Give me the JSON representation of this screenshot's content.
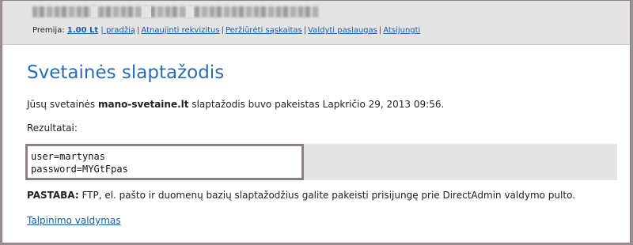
{
  "nav": {
    "premium_label": "Premija:",
    "premium_amount": "1.00 Lt",
    "links": [
      "| pradžią",
      "Atnaujinti rekvizitus",
      "Peržiūrėti sąskaitas",
      "Valdyti paslaugas",
      "Atsijungti"
    ]
  },
  "main": {
    "title": "Svetainės slaptažodis",
    "message_prefix": "Jūsų svetainės ",
    "site_name": "mano-svetaine.lt",
    "message_suffix": " slaptažodis buvo pakeistas Lapkričio 29, 2013 09:56.",
    "results_label": "Rezultatai:",
    "result_lines": [
      "user=martynas",
      "password=MYGtFpas"
    ],
    "note_label": "PASTABA:",
    "note_text": " FTP, el. pašto ir duomenų bazių slaptažodžius galite pakeisti prisijungę prie DirectAdmin valdymo pulto.",
    "footer_link": "Talpinimo valdymas"
  },
  "colors": {
    "title": "#2a6db5",
    "link": "#1a5ea8",
    "result_border": "#8f7f86",
    "header_bg": "#e4e4e4"
  }
}
